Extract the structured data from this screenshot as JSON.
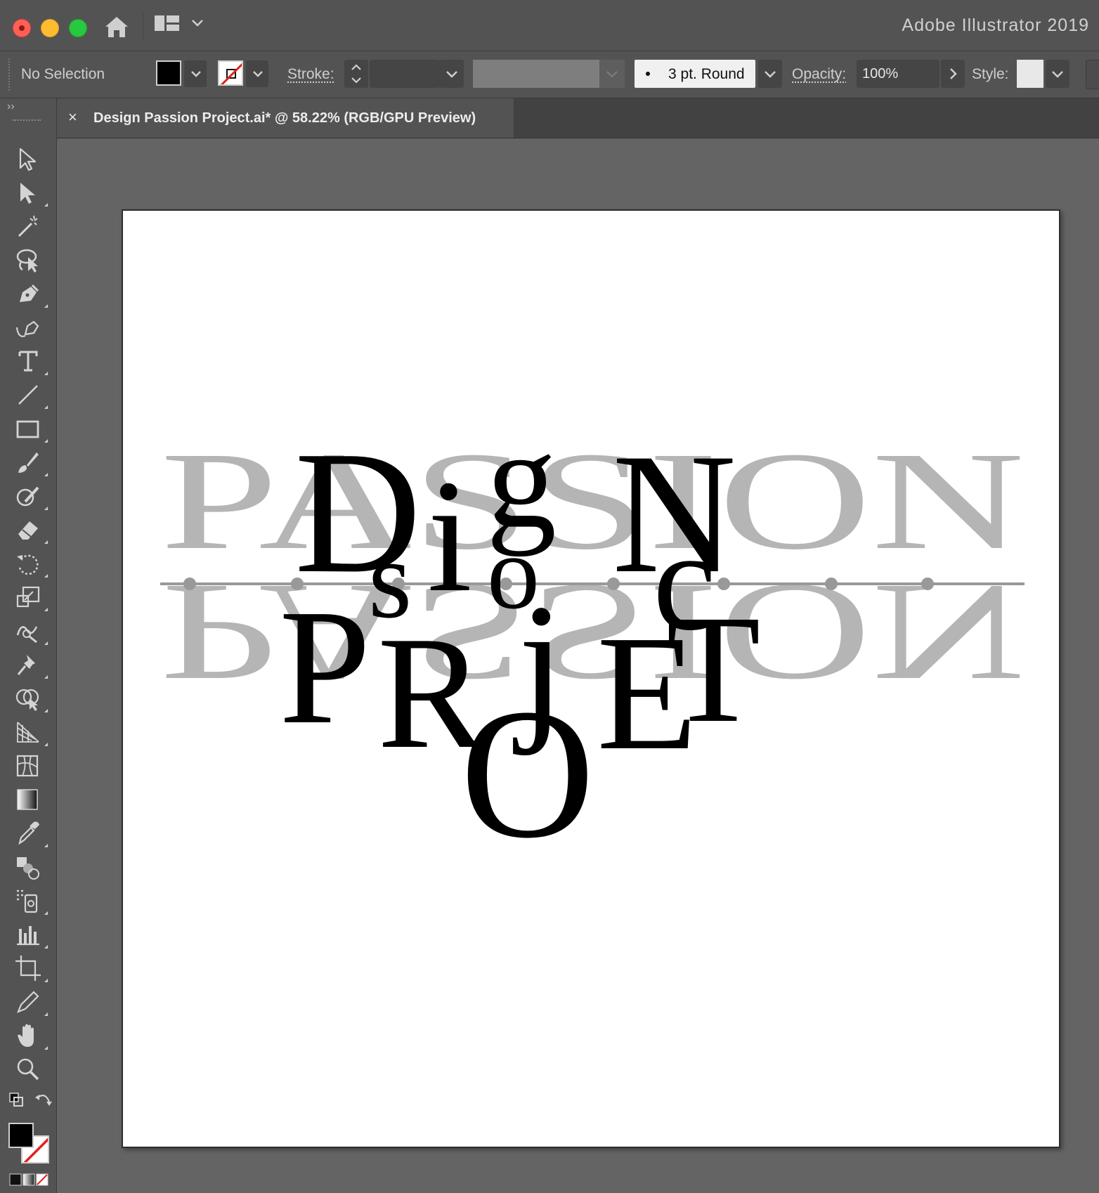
{
  "window": {
    "app_title": "Adobe Illustrator 2019"
  },
  "control_bar": {
    "selection_status": "No Selection",
    "stroke_label": "Stroke:",
    "brush_label": "3 pt. Round",
    "opacity_label": "Opacity:",
    "opacity_value": "100%",
    "style_label": "Style:"
  },
  "document": {
    "tab_close": "×",
    "tab_title": "Design Passion Project.ai* @ 58.22% (RGB/GPU Preview)"
  },
  "toolbar": {
    "collapse_label": "››"
  },
  "artwork": {
    "back_word": "PASSION",
    "letters": {
      "D": "D",
      "s": "s",
      "i": "i",
      "g": "g",
      "N": "N",
      "c": "c",
      "T": "T",
      "P": "P",
      "R": "R",
      "j": "j",
      "E": "E",
      "O": "O",
      "o": "o"
    }
  },
  "colors": {
    "chrome": "#535353",
    "canvas": "#646464",
    "artboard": "#ffffff",
    "foreground_type": "#000000",
    "background_type": "#b5b5b5"
  }
}
